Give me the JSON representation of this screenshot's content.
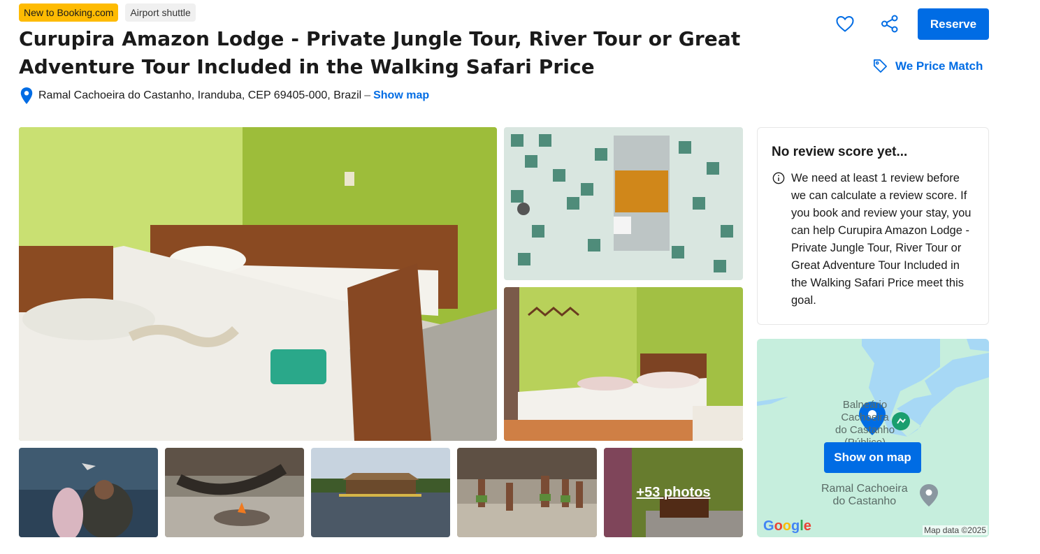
{
  "badges": {
    "new": "New to Booking.com",
    "shuttle": "Airport shuttle"
  },
  "title": "Curupira Amazon Lodge - Private Jungle Tour, River Tour or Great Adventure Tour Included in the Walking Safari Price",
  "address": {
    "text": "Ramal Cachoeira do Castanho, Iranduba, CEP 69405-000, Brazil",
    "separator": "–",
    "show_map": "Show map"
  },
  "actions": {
    "favorite_icon": "heart-icon",
    "share_icon": "share-icon",
    "reserve_label": "Reserve",
    "price_match_label": "We Price Match",
    "price_match_icon": "tag-icon"
  },
  "gallery": {
    "more_photos_label": "+53 photos"
  },
  "review": {
    "heading": "No review score yet...",
    "info_icon": "info-icon",
    "message": "We need at least 1 review before we can calculate a review score. If you book and review your stay, you can help Curupira Amazon Lodge - Private Jungle Tour, River Tour or Great Adventure Tour Included in the Walking Safari Price meet this goal."
  },
  "map": {
    "button_label": "Show on map",
    "place_balneario": "Balneário Cachoeira do Castanho (Público)",
    "place_balneario_lines": [
      "Balneário",
      "Cachoeira",
      "do Castanho",
      "(Público)"
    ],
    "place_ramal_lines": [
      "Ramal Cachoeira",
      "do Castanho"
    ],
    "google": "Google",
    "credit": "Map data ©2025"
  },
  "colors": {
    "brand_blue": "#006ce4",
    "badge_yellow": "#febb02",
    "map_water": "#a7d8f5",
    "map_land": "#c6eedd"
  }
}
